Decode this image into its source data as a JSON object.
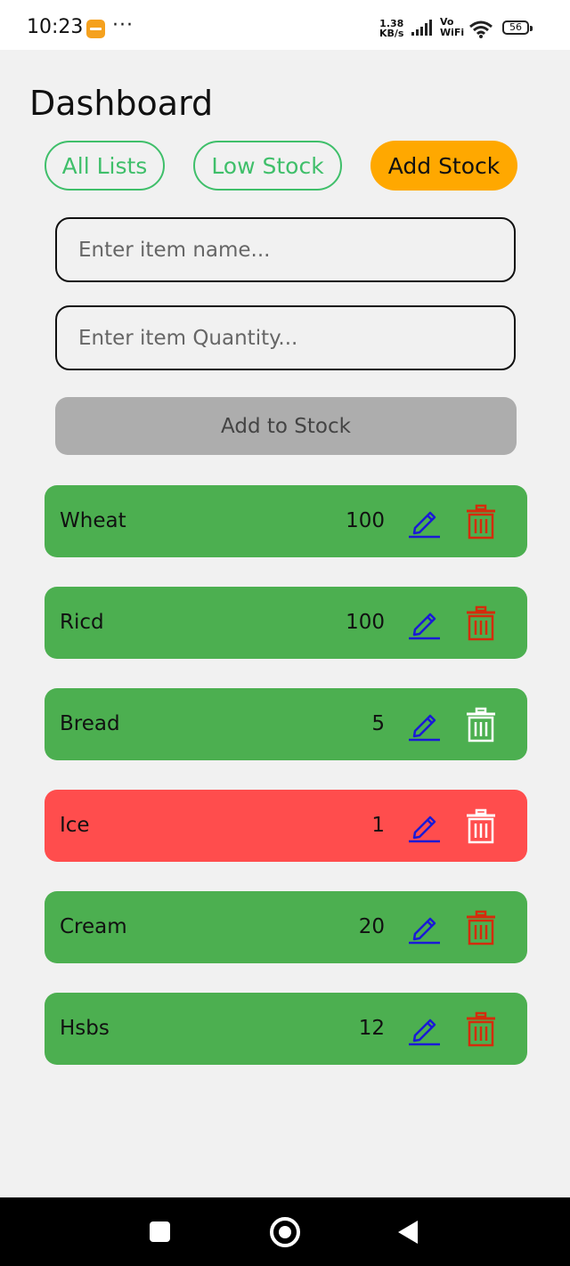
{
  "status_bar": {
    "time": "10:23",
    "dots": "···",
    "speed_value": "1.38",
    "speed_unit": "KB/s",
    "vo": "Vo",
    "wifi_label": "WiFi",
    "battery": "56"
  },
  "page": {
    "title": "Dashboard"
  },
  "tabs": [
    {
      "label": "All Lists",
      "active": false
    },
    {
      "label": "Low Stock",
      "active": false
    },
    {
      "label": "Add Stock",
      "active": true
    }
  ],
  "form": {
    "name_placeholder": "Enter item name...",
    "quantity_placeholder": "Enter item Quantity...",
    "submit_label": "Add to Stock"
  },
  "items": [
    {
      "name": "Wheat",
      "quantity": "100",
      "status": "ok"
    },
    {
      "name": "Ricd",
      "quantity": "100",
      "status": "ok"
    },
    {
      "name": "Bread",
      "quantity": "5",
      "status": "ok"
    },
    {
      "name": "Ice",
      "quantity": "1",
      "status": "low"
    },
    {
      "name": "Cream",
      "quantity": "20",
      "status": "ok"
    },
    {
      "name": "Hsbs",
      "quantity": "12",
      "status": "ok"
    }
  ],
  "colors": {
    "ok_row": "#4caf50",
    "low_row": "#ff4d4d",
    "accent_tab": "#ffa800",
    "outline_tab": "#3fbf6a",
    "edit_icon": "#1a1ad6",
    "trash_icon_red": "#d42c0c",
    "trash_icon_white": "#ffffff"
  },
  "icons": {
    "edit": "pencil-icon",
    "delete": "trash-icon"
  }
}
